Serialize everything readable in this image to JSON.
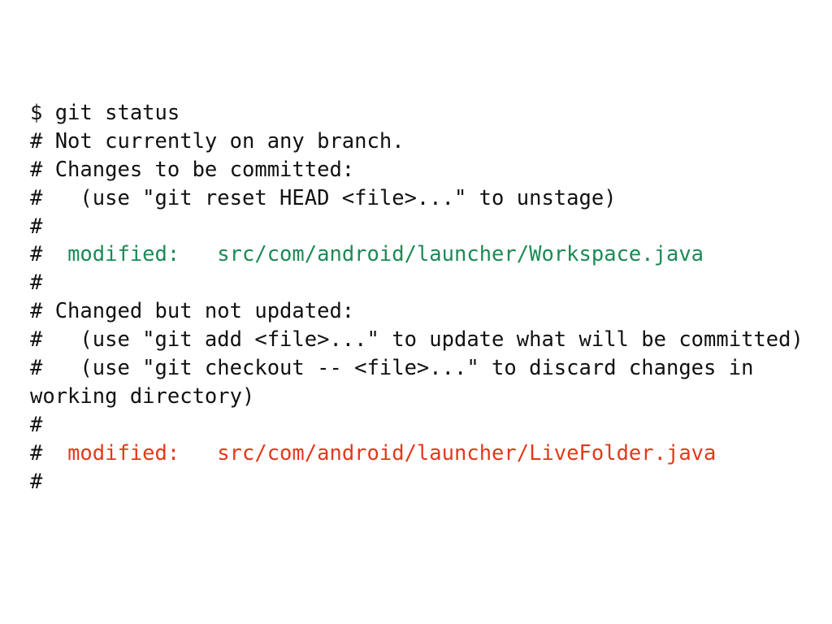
{
  "colors": {
    "background": "#ffffff",
    "text": "#111111",
    "staged": "#1c8a56",
    "unstaged": "#e2391b"
  },
  "lines": {
    "prompt": "$ git status",
    "not_on_branch": "# Not currently on any branch.",
    "changes_to_commit": "# Changes to be committed:",
    "reset_hint": "#   (use \"git reset HEAD <file>...\" to unstage)",
    "hash_1": "#",
    "staged_prefix": "#  ",
    "staged_label": "modified:",
    "staged_gap": "   ",
    "staged_path": "src/com/android/launcher/Workspace.java",
    "hash_2": "#",
    "changed_not_updated": "# Changed but not updated:",
    "add_hint": "#   (use \"git add <file>...\" to update what will be committed)",
    "checkout_hint": "#   (use \"git checkout -- <file>...\" to discard changes in",
    "checkout_hint_wrap": "working directory)",
    "hash_3": "#",
    "unstaged_prefix": "#  ",
    "unstaged_label": "modified:",
    "unstaged_gap": "   ",
    "unstaged_path": "src/com/android/launcher/LiveFolder.java",
    "hash_4": "#"
  }
}
